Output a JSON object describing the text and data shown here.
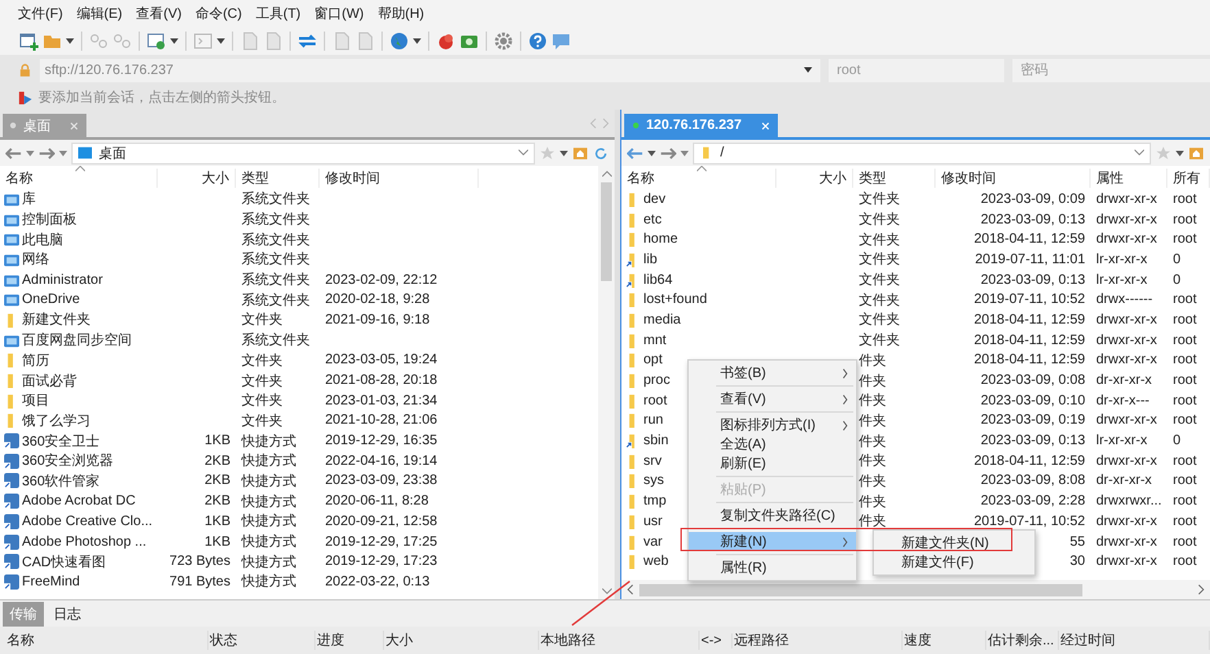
{
  "menu_bar": [
    "文件(F)",
    "编辑(E)",
    "查看(V)",
    "命令(C)",
    "工具(T)",
    "窗口(W)",
    "帮助(H)"
  ],
  "session_bar": {
    "address": "sftp://120.76.176.237",
    "user": "root",
    "password_placeholder": "密码"
  },
  "hint": "要添加当前会话，点击左侧的箭头按钮。",
  "left_pane": {
    "tab": {
      "label": "桌面",
      "selected": false,
      "connected": false
    },
    "path": "桌面",
    "columns": [
      "名称",
      "大小",
      "类型",
      "修改时间"
    ],
    "rows": [
      {
        "kind": "system",
        "name": "库",
        "type": "系统文件夹"
      },
      {
        "kind": "system",
        "name": "控制面板",
        "type": "系统文件夹"
      },
      {
        "kind": "system",
        "name": "此电脑",
        "type": "系统文件夹"
      },
      {
        "kind": "system",
        "name": "网络",
        "type": "系统文件夹"
      },
      {
        "kind": "system",
        "name": "Administrator",
        "type": "系统文件夹",
        "modified": "2023-02-09, 22:12"
      },
      {
        "kind": "system",
        "name": "OneDrive",
        "type": "系统文件夹",
        "modified": "2020-02-18, 9:28"
      },
      {
        "kind": "folder",
        "name": "新建文件夹",
        "type": "文件夹",
        "modified": "2021-09-16, 9:18"
      },
      {
        "kind": "system",
        "name": "百度网盘同步空间",
        "type": "系统文件夹"
      },
      {
        "kind": "folder",
        "name": "简历",
        "type": "文件夹",
        "modified": "2023-03-05, 19:24"
      },
      {
        "kind": "folder",
        "name": "面试必背",
        "type": "文件夹",
        "modified": "2021-08-28, 20:18"
      },
      {
        "kind": "folder",
        "name": "项目",
        "type": "文件夹",
        "modified": "2023-01-03, 21:34"
      },
      {
        "kind": "folder",
        "name": "饿了么学习",
        "type": "文件夹",
        "modified": "2021-10-28, 21:06"
      },
      {
        "kind": "shortcut",
        "name": "360安全卫士",
        "size": "1KB",
        "type": "快捷方式",
        "modified": "2019-12-29, 16:35"
      },
      {
        "kind": "shortcut",
        "name": "360安全浏览器",
        "size": "2KB",
        "type": "快捷方式",
        "modified": "2022-04-16, 19:14"
      },
      {
        "kind": "shortcut",
        "name": "360软件管家",
        "size": "2KB",
        "type": "快捷方式",
        "modified": "2023-03-09, 23:38"
      },
      {
        "kind": "shortcut",
        "name": "Adobe Acrobat DC",
        "size": "2KB",
        "type": "快捷方式",
        "modified": "2020-06-11, 8:28"
      },
      {
        "kind": "shortcut",
        "name": "Adobe Creative Clo...",
        "size": "1KB",
        "type": "快捷方式",
        "modified": "2020-09-21, 12:58"
      },
      {
        "kind": "shortcut",
        "name": "Adobe Photoshop ...",
        "size": "1KB",
        "type": "快捷方式",
        "modified": "2019-12-29, 17:25"
      },
      {
        "kind": "shortcut",
        "name": "CAD快速看图",
        "size": "723 Bytes",
        "type": "快捷方式",
        "modified": "2019-12-29, 17:23"
      },
      {
        "kind": "shortcut",
        "name": "FreeMind",
        "size": "791 Bytes",
        "type": "快捷方式",
        "modified": "2022-03-22, 0:13"
      }
    ]
  },
  "right_pane": {
    "tab": {
      "label": "120.76.176.237",
      "selected": true,
      "connected": true
    },
    "path": "/",
    "columns": [
      "名称",
      "大小",
      "类型",
      "修改时间",
      "属性",
      "所有"
    ],
    "rows": [
      {
        "kind": "folder",
        "name": "dev",
        "type": "文件夹",
        "modified": "2023-03-09, 0:09",
        "attributes": "drwxr-xr-x",
        "owner": "root"
      },
      {
        "kind": "folder",
        "name": "etc",
        "type": "文件夹",
        "modified": "2023-03-09, 0:13",
        "attributes": "drwxr-xr-x",
        "owner": "root"
      },
      {
        "kind": "folder",
        "name": "home",
        "type": "文件夹",
        "modified": "2018-04-11, 12:59",
        "attributes": "drwxr-xr-x",
        "owner": "root"
      },
      {
        "kind": "link",
        "name": "lib",
        "type": "文件夹",
        "modified": "2019-07-11, 11:01",
        "attributes": "lr-xr-xr-x",
        "owner": "0"
      },
      {
        "kind": "link",
        "name": "lib64",
        "type": "文件夹",
        "modified": "2023-03-09, 0:13",
        "attributes": "lr-xr-xr-x",
        "owner": "0"
      },
      {
        "kind": "folder",
        "name": "lost+found",
        "type": "文件夹",
        "modified": "2019-07-11, 10:52",
        "attributes": "drwx------",
        "owner": "root"
      },
      {
        "kind": "folder",
        "name": "media",
        "type": "文件夹",
        "modified": "2018-04-11, 12:59",
        "attributes": "drwxr-xr-x",
        "owner": "root"
      },
      {
        "kind": "folder",
        "name": "mnt",
        "type": "文件夹",
        "modified": "2018-04-11, 12:59",
        "attributes": "drwxr-xr-x",
        "owner": "root"
      },
      {
        "kind": "folder",
        "name": "opt",
        "type": "件夹",
        "modified": "2018-04-11, 12:59",
        "attributes": "drwxr-xr-x",
        "owner": "root"
      },
      {
        "kind": "folder",
        "name": "proc",
        "type": "件夹",
        "modified": "2023-03-09, 0:08",
        "attributes": "dr-xr-xr-x",
        "owner": "root"
      },
      {
        "kind": "folder",
        "name": "root",
        "type": "件夹",
        "modified": "2023-03-09, 0:10",
        "attributes": "dr-xr-x---",
        "owner": "root"
      },
      {
        "kind": "folder",
        "name": "run",
        "type": "件夹",
        "modified": "2023-03-09, 0:19",
        "attributes": "drwxr-xr-x",
        "owner": "root"
      },
      {
        "kind": "link",
        "name": "sbin",
        "type": "件夹",
        "modified": "2023-03-09, 0:13",
        "attributes": "lr-xr-xr-x",
        "owner": "0"
      },
      {
        "kind": "folder",
        "name": "srv",
        "type": "件夹",
        "modified": "2018-04-11, 12:59",
        "attributes": "drwxr-xr-x",
        "owner": "root"
      },
      {
        "kind": "folder",
        "name": "sys",
        "type": "件夹",
        "modified": "2023-03-09, 8:08",
        "attributes": "dr-xr-xr-x",
        "owner": "root"
      },
      {
        "kind": "folder",
        "name": "tmp",
        "type": "件夹",
        "modified": "2023-03-09, 2:28",
        "attributes": "drwxrwxr...",
        "owner": "root"
      },
      {
        "kind": "folder",
        "name": "usr",
        "type": "件夹",
        "modified": "2019-07-11, 10:52",
        "attributes": "drwxr-xr-x",
        "owner": "root"
      },
      {
        "kind": "folder",
        "name": "var",
        "modified": "55",
        "attributes": "drwxr-xr-x",
        "owner": "root"
      },
      {
        "kind": "folder",
        "name": "web",
        "modified": "30",
        "attributes": "drwxr-xr-x",
        "owner": "root"
      }
    ]
  },
  "context_menu": {
    "items": [
      {
        "kind": "item",
        "label": "书签(B)",
        "submenu": true,
        "disabled": false,
        "selected": false
      },
      {
        "kind": "separator"
      },
      {
        "kind": "item",
        "label": "查看(V)",
        "submenu": true,
        "disabled": false,
        "selected": false
      },
      {
        "kind": "separator"
      },
      {
        "kind": "item",
        "label": "图标排列方式(I)",
        "submenu": true,
        "disabled": false,
        "selected": false
      },
      {
        "kind": "item",
        "label": "全选(A)",
        "submenu": false,
        "disabled": false,
        "selected": false
      },
      {
        "kind": "item",
        "label": "刷新(E)",
        "submenu": false,
        "disabled": false,
        "selected": false
      },
      {
        "kind": "separator"
      },
      {
        "kind": "item",
        "label": "粘贴(P)",
        "submenu": false,
        "disabled": true,
        "selected": false
      },
      {
        "kind": "separator"
      },
      {
        "kind": "item",
        "label": "复制文件夹路径(C)",
        "submenu": false,
        "disabled": false,
        "selected": false
      },
      {
        "kind": "separator"
      },
      {
        "kind": "item",
        "label": "新建(N)",
        "submenu": true,
        "disabled": false,
        "selected": true
      },
      {
        "kind": "separator"
      },
      {
        "kind": "item",
        "label": "属性(R)",
        "submenu": false,
        "disabled": false,
        "selected": false
      }
    ],
    "submenu": [
      {
        "label": "新建文件夹(N)"
      },
      {
        "label": "新建文件(F)"
      }
    ]
  },
  "bottom_tabs": [
    {
      "label": "传输",
      "selected": true
    },
    {
      "label": "日志",
      "selected": false
    }
  ],
  "transfer_columns": [
    "名称",
    "状态",
    "进度",
    "大小",
    "本地路径",
    "<->",
    "远程路径",
    "速度",
    "估计剩余...",
    "经过时间"
  ]
}
